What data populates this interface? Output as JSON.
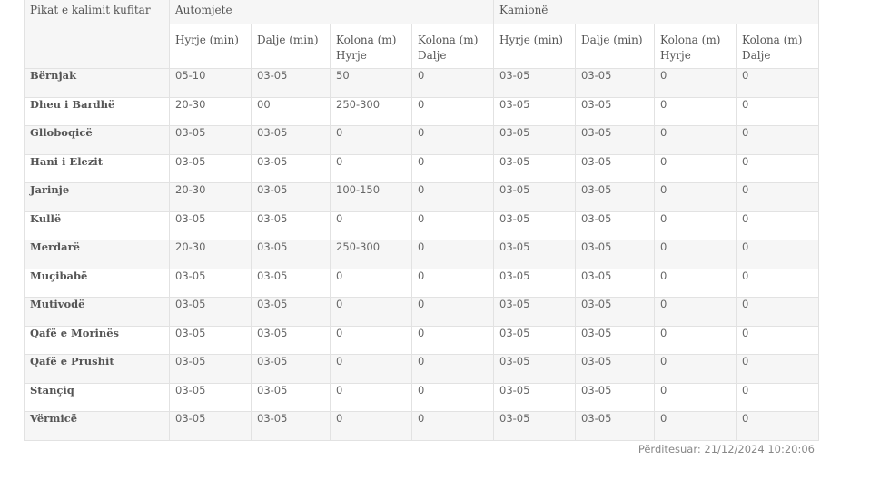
{
  "table": {
    "point_header": "Pikat e kalimit kufitar",
    "group_cars": "Automjete",
    "group_trucks": "Kamionë",
    "columns": [
      "Hyrje (min)",
      "Dalje (min)",
      "Kolona (m) Hyrje",
      "Kolona (m) Dalje",
      "Hyrje (min)",
      "Dalje (min)",
      "Kolona (m) Hyrje",
      "Kolona (m) Dalje"
    ],
    "rows": [
      {
        "name": "Bërnjak",
        "values": [
          "05-10",
          "03-05",
          "50",
          "0",
          "03-05",
          "03-05",
          "0",
          "0"
        ]
      },
      {
        "name": "Dheu i Bardhë",
        "values": [
          "20-30",
          "00",
          "250-300",
          "0",
          "03-05",
          "03-05",
          "0",
          "0"
        ]
      },
      {
        "name": "Glloboqicë",
        "values": [
          "03-05",
          "03-05",
          "0",
          "0",
          "03-05",
          "03-05",
          "0",
          "0"
        ]
      },
      {
        "name": "Hani i Elezit",
        "values": [
          "03-05",
          "03-05",
          "0",
          "0",
          "03-05",
          "03-05",
          "0",
          "0"
        ]
      },
      {
        "name": "Jarinje",
        "values": [
          "20-30",
          "03-05",
          "100-150",
          "0",
          "03-05",
          "03-05",
          "0",
          "0"
        ]
      },
      {
        "name": "Kullë",
        "values": [
          "03-05",
          "03-05",
          "0",
          "0",
          "03-05",
          "03-05",
          "0",
          "0"
        ]
      },
      {
        "name": "Merdarë",
        "values": [
          "20-30",
          "03-05",
          "250-300",
          "0",
          "03-05",
          "03-05",
          "0",
          "0"
        ]
      },
      {
        "name": "Muçibabë",
        "values": [
          "03-05",
          "03-05",
          "0",
          "0",
          "03-05",
          "03-05",
          "0",
          "0"
        ]
      },
      {
        "name": "Mutivodë",
        "values": [
          "03-05",
          "03-05",
          "0",
          "0",
          "03-05",
          "03-05",
          "0",
          "0"
        ]
      },
      {
        "name": "Qafë e Morinës",
        "values": [
          "03-05",
          "03-05",
          "0",
          "0",
          "03-05",
          "03-05",
          "0",
          "0"
        ]
      },
      {
        "name": "Qafë e Prushit",
        "values": [
          "03-05",
          "03-05",
          "0",
          "0",
          "03-05",
          "03-05",
          "0",
          "0"
        ]
      },
      {
        "name": "Stançiq",
        "values": [
          "03-05",
          "03-05",
          "0",
          "0",
          "03-05",
          "03-05",
          "0",
          "0"
        ]
      },
      {
        "name": "Vërmicë",
        "values": [
          "03-05",
          "03-05",
          "0",
          "0",
          "03-05",
          "03-05",
          "0",
          "0"
        ]
      }
    ]
  },
  "footer": {
    "updated": "Përditesuar: 21/12/2024 10:20:06"
  }
}
